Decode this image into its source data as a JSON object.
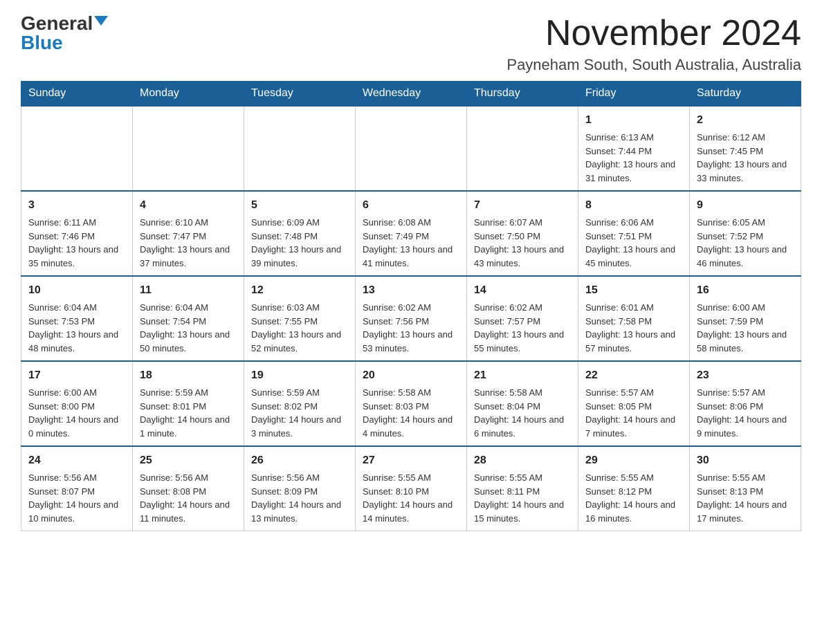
{
  "header": {
    "logo_general": "General",
    "logo_blue": "Blue",
    "month_title": "November 2024",
    "location": "Payneham South, South Australia, Australia"
  },
  "days_of_week": [
    "Sunday",
    "Monday",
    "Tuesday",
    "Wednesday",
    "Thursday",
    "Friday",
    "Saturday"
  ],
  "weeks": [
    [
      {
        "day": "",
        "info": ""
      },
      {
        "day": "",
        "info": ""
      },
      {
        "day": "",
        "info": ""
      },
      {
        "day": "",
        "info": ""
      },
      {
        "day": "",
        "info": ""
      },
      {
        "day": "1",
        "info": "Sunrise: 6:13 AM\nSunset: 7:44 PM\nDaylight: 13 hours and 31 minutes."
      },
      {
        "day": "2",
        "info": "Sunrise: 6:12 AM\nSunset: 7:45 PM\nDaylight: 13 hours and 33 minutes."
      }
    ],
    [
      {
        "day": "3",
        "info": "Sunrise: 6:11 AM\nSunset: 7:46 PM\nDaylight: 13 hours and 35 minutes."
      },
      {
        "day": "4",
        "info": "Sunrise: 6:10 AM\nSunset: 7:47 PM\nDaylight: 13 hours and 37 minutes."
      },
      {
        "day": "5",
        "info": "Sunrise: 6:09 AM\nSunset: 7:48 PM\nDaylight: 13 hours and 39 minutes."
      },
      {
        "day": "6",
        "info": "Sunrise: 6:08 AM\nSunset: 7:49 PM\nDaylight: 13 hours and 41 minutes."
      },
      {
        "day": "7",
        "info": "Sunrise: 6:07 AM\nSunset: 7:50 PM\nDaylight: 13 hours and 43 minutes."
      },
      {
        "day": "8",
        "info": "Sunrise: 6:06 AM\nSunset: 7:51 PM\nDaylight: 13 hours and 45 minutes."
      },
      {
        "day": "9",
        "info": "Sunrise: 6:05 AM\nSunset: 7:52 PM\nDaylight: 13 hours and 46 minutes."
      }
    ],
    [
      {
        "day": "10",
        "info": "Sunrise: 6:04 AM\nSunset: 7:53 PM\nDaylight: 13 hours and 48 minutes."
      },
      {
        "day": "11",
        "info": "Sunrise: 6:04 AM\nSunset: 7:54 PM\nDaylight: 13 hours and 50 minutes."
      },
      {
        "day": "12",
        "info": "Sunrise: 6:03 AM\nSunset: 7:55 PM\nDaylight: 13 hours and 52 minutes."
      },
      {
        "day": "13",
        "info": "Sunrise: 6:02 AM\nSunset: 7:56 PM\nDaylight: 13 hours and 53 minutes."
      },
      {
        "day": "14",
        "info": "Sunrise: 6:02 AM\nSunset: 7:57 PM\nDaylight: 13 hours and 55 minutes."
      },
      {
        "day": "15",
        "info": "Sunrise: 6:01 AM\nSunset: 7:58 PM\nDaylight: 13 hours and 57 minutes."
      },
      {
        "day": "16",
        "info": "Sunrise: 6:00 AM\nSunset: 7:59 PM\nDaylight: 13 hours and 58 minutes."
      }
    ],
    [
      {
        "day": "17",
        "info": "Sunrise: 6:00 AM\nSunset: 8:00 PM\nDaylight: 14 hours and 0 minutes."
      },
      {
        "day": "18",
        "info": "Sunrise: 5:59 AM\nSunset: 8:01 PM\nDaylight: 14 hours and 1 minute."
      },
      {
        "day": "19",
        "info": "Sunrise: 5:59 AM\nSunset: 8:02 PM\nDaylight: 14 hours and 3 minutes."
      },
      {
        "day": "20",
        "info": "Sunrise: 5:58 AM\nSunset: 8:03 PM\nDaylight: 14 hours and 4 minutes."
      },
      {
        "day": "21",
        "info": "Sunrise: 5:58 AM\nSunset: 8:04 PM\nDaylight: 14 hours and 6 minutes."
      },
      {
        "day": "22",
        "info": "Sunrise: 5:57 AM\nSunset: 8:05 PM\nDaylight: 14 hours and 7 minutes."
      },
      {
        "day": "23",
        "info": "Sunrise: 5:57 AM\nSunset: 8:06 PM\nDaylight: 14 hours and 9 minutes."
      }
    ],
    [
      {
        "day": "24",
        "info": "Sunrise: 5:56 AM\nSunset: 8:07 PM\nDaylight: 14 hours and 10 minutes."
      },
      {
        "day": "25",
        "info": "Sunrise: 5:56 AM\nSunset: 8:08 PM\nDaylight: 14 hours and 11 minutes."
      },
      {
        "day": "26",
        "info": "Sunrise: 5:56 AM\nSunset: 8:09 PM\nDaylight: 14 hours and 13 minutes."
      },
      {
        "day": "27",
        "info": "Sunrise: 5:55 AM\nSunset: 8:10 PM\nDaylight: 14 hours and 14 minutes."
      },
      {
        "day": "28",
        "info": "Sunrise: 5:55 AM\nSunset: 8:11 PM\nDaylight: 14 hours and 15 minutes."
      },
      {
        "day": "29",
        "info": "Sunrise: 5:55 AM\nSunset: 8:12 PM\nDaylight: 14 hours and 16 minutes."
      },
      {
        "day": "30",
        "info": "Sunrise: 5:55 AM\nSunset: 8:13 PM\nDaylight: 14 hours and 17 minutes."
      }
    ]
  ]
}
